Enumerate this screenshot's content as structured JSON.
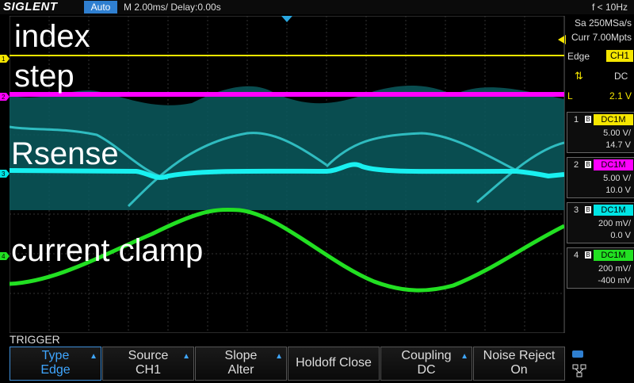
{
  "header": {
    "brand": "SIGLENT",
    "mode": "Auto",
    "timebase": "M 2.00ms/ Delay:0.00s",
    "frequency": "f < 10Hz"
  },
  "labels": {
    "index": "index",
    "step": "step",
    "rsense": "Rsense",
    "clamp": "current clamp"
  },
  "acq": {
    "sample": "Sa 250MSa/s",
    "memory": "Curr 7.00Mpts"
  },
  "trigger_panel": {
    "type": "Edge",
    "source": "CH1",
    "coupling": "DC",
    "level_prefix": "L",
    "level": "2.1 V"
  },
  "channels": [
    {
      "num": "1",
      "coupling": "DC1M",
      "scale": "5.00 V/",
      "offset": "14.7 V",
      "color": "#f5e600"
    },
    {
      "num": "2",
      "coupling": "DC1M",
      "scale": "5.00 V/",
      "offset": "10.0 V",
      "color": "#ff00ff"
    },
    {
      "num": "3",
      "coupling": "DC1M",
      "scale": "200 mV/",
      "offset": "0.0 V",
      "color": "#00e5e5"
    },
    {
      "num": "4",
      "coupling": "DC1M",
      "scale": "200 mV/",
      "offset": "-400 mV",
      "color": "#22e022"
    }
  ],
  "markers": {
    "m1": "1",
    "m2": "2",
    "m3": "3",
    "m4": "4"
  },
  "menu": {
    "title": "TRIGGER",
    "softkeys": [
      {
        "line1": "Type",
        "line2": "Edge"
      },
      {
        "line1": "Source",
        "line2": "CH1"
      },
      {
        "line1": "Slope",
        "line2": "Alter"
      },
      {
        "single": "Holdoff Close"
      },
      {
        "line1": "Coupling",
        "line2": "DC"
      },
      {
        "line1": "Noise Reject",
        "line2": "On"
      }
    ]
  }
}
